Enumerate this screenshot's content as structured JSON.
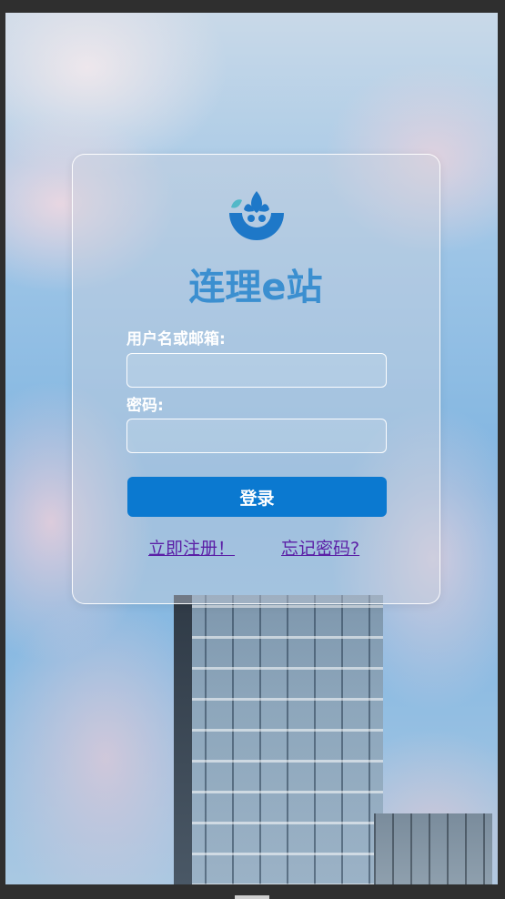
{
  "login": {
    "site_title": "连理e站",
    "username_label": "用户名或邮箱:",
    "username_value": "",
    "password_label": "密码:",
    "password_value": "",
    "login_button": "登录",
    "register_link": "立即注册！",
    "forgot_link": "忘记密码?"
  },
  "colors": {
    "brand": "#3b8fd0",
    "button": "#0b79d0",
    "link": "#5b1fa6"
  },
  "icons": {
    "logo": "lotus-logo-icon"
  }
}
